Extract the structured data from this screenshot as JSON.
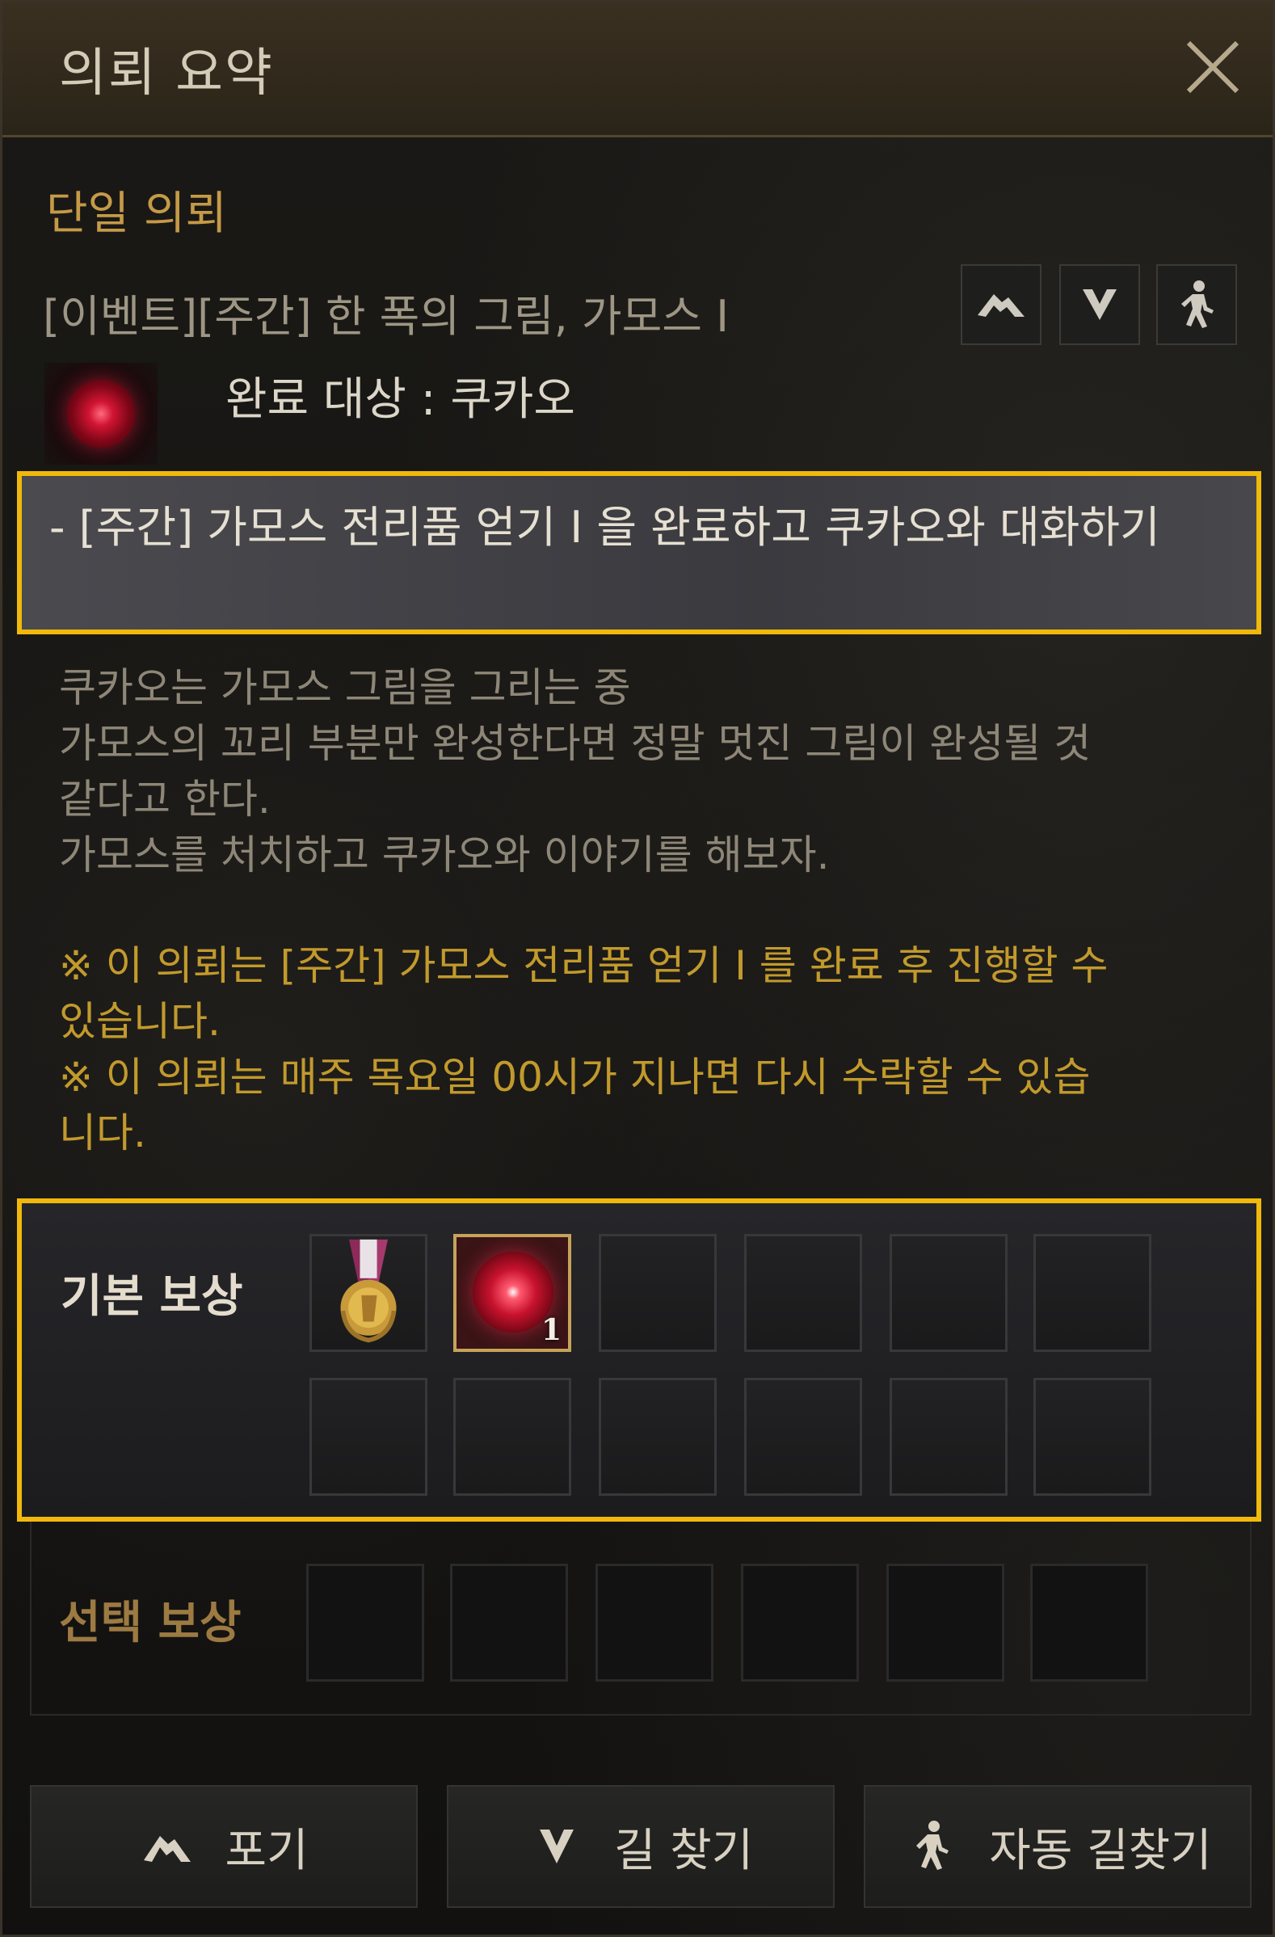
{
  "window": {
    "title": "의뢰 요약"
  },
  "section": {
    "label": "단일 의뢰"
  },
  "quest": {
    "name": "[이벤트][주간] 한 폭의 그림, 가모스 I",
    "target": "완료 대상 : 쿠카오",
    "objective": "- [주간] 가모스 전리품 얻기 I 을 완료하고 쿠카오와 대화하기",
    "description": "쿠카오는 가모스 그림을 그리는 중\n가모스의 꼬리 부분만 완성한다면 정말 멋진 그림이 완성될 것\n 같다고 한다.\n가모스를 처치하고 쿠카오와 이야기를 해보자.",
    "notes": "※ 이 의뢰는 [주간] 가모스 전리품 얻기 I 를 완료 후 진행할 수\n 있습니다.\n※ 이 의뢰는 매주 목요일 00시가 지나면 다시 수락할 수 있습\n니다."
  },
  "rewards": {
    "basic_label": "기본 보상",
    "choice_label": "선택 보상",
    "basic_items": [
      {
        "icon": "medal-icon",
        "count": ""
      },
      {
        "icon": "red-orb-icon",
        "count": "1"
      }
    ]
  },
  "buttons": {
    "give_up": "포기",
    "pathfind": "길 찾기",
    "auto_pathfind": "자동 길찾기"
  },
  "colors": {
    "accent_gold": "#c59a47",
    "highlight": "#f0b90b",
    "note_text": "#c29a2c"
  }
}
